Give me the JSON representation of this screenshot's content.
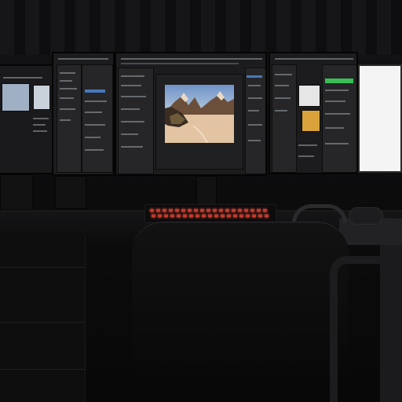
{
  "scene": {
    "description_free": true,
    "colors": {
      "background": "#0b0b0c",
      "monitor_frame": "#1c1c1e",
      "keyboard_backlight": "#c0392b",
      "accent_blue": "#4f8de0",
      "accent_green": "#3ecf5a",
      "bright_screen": "#f4f4f4"
    },
    "icons": {
      "far_left_monitor": "monitor-icon",
      "left_monitor": "monitor-icon",
      "center_monitor": "monitor-icon",
      "right_monitor": "monitor-icon",
      "bright_monitor": "monitor-icon",
      "keyboard": "keyboard-icon",
      "mouse": "mouse-icon",
      "headphones": "headphones-icon",
      "chair": "chair-icon",
      "photo": "landscape-image-icon"
    }
  }
}
